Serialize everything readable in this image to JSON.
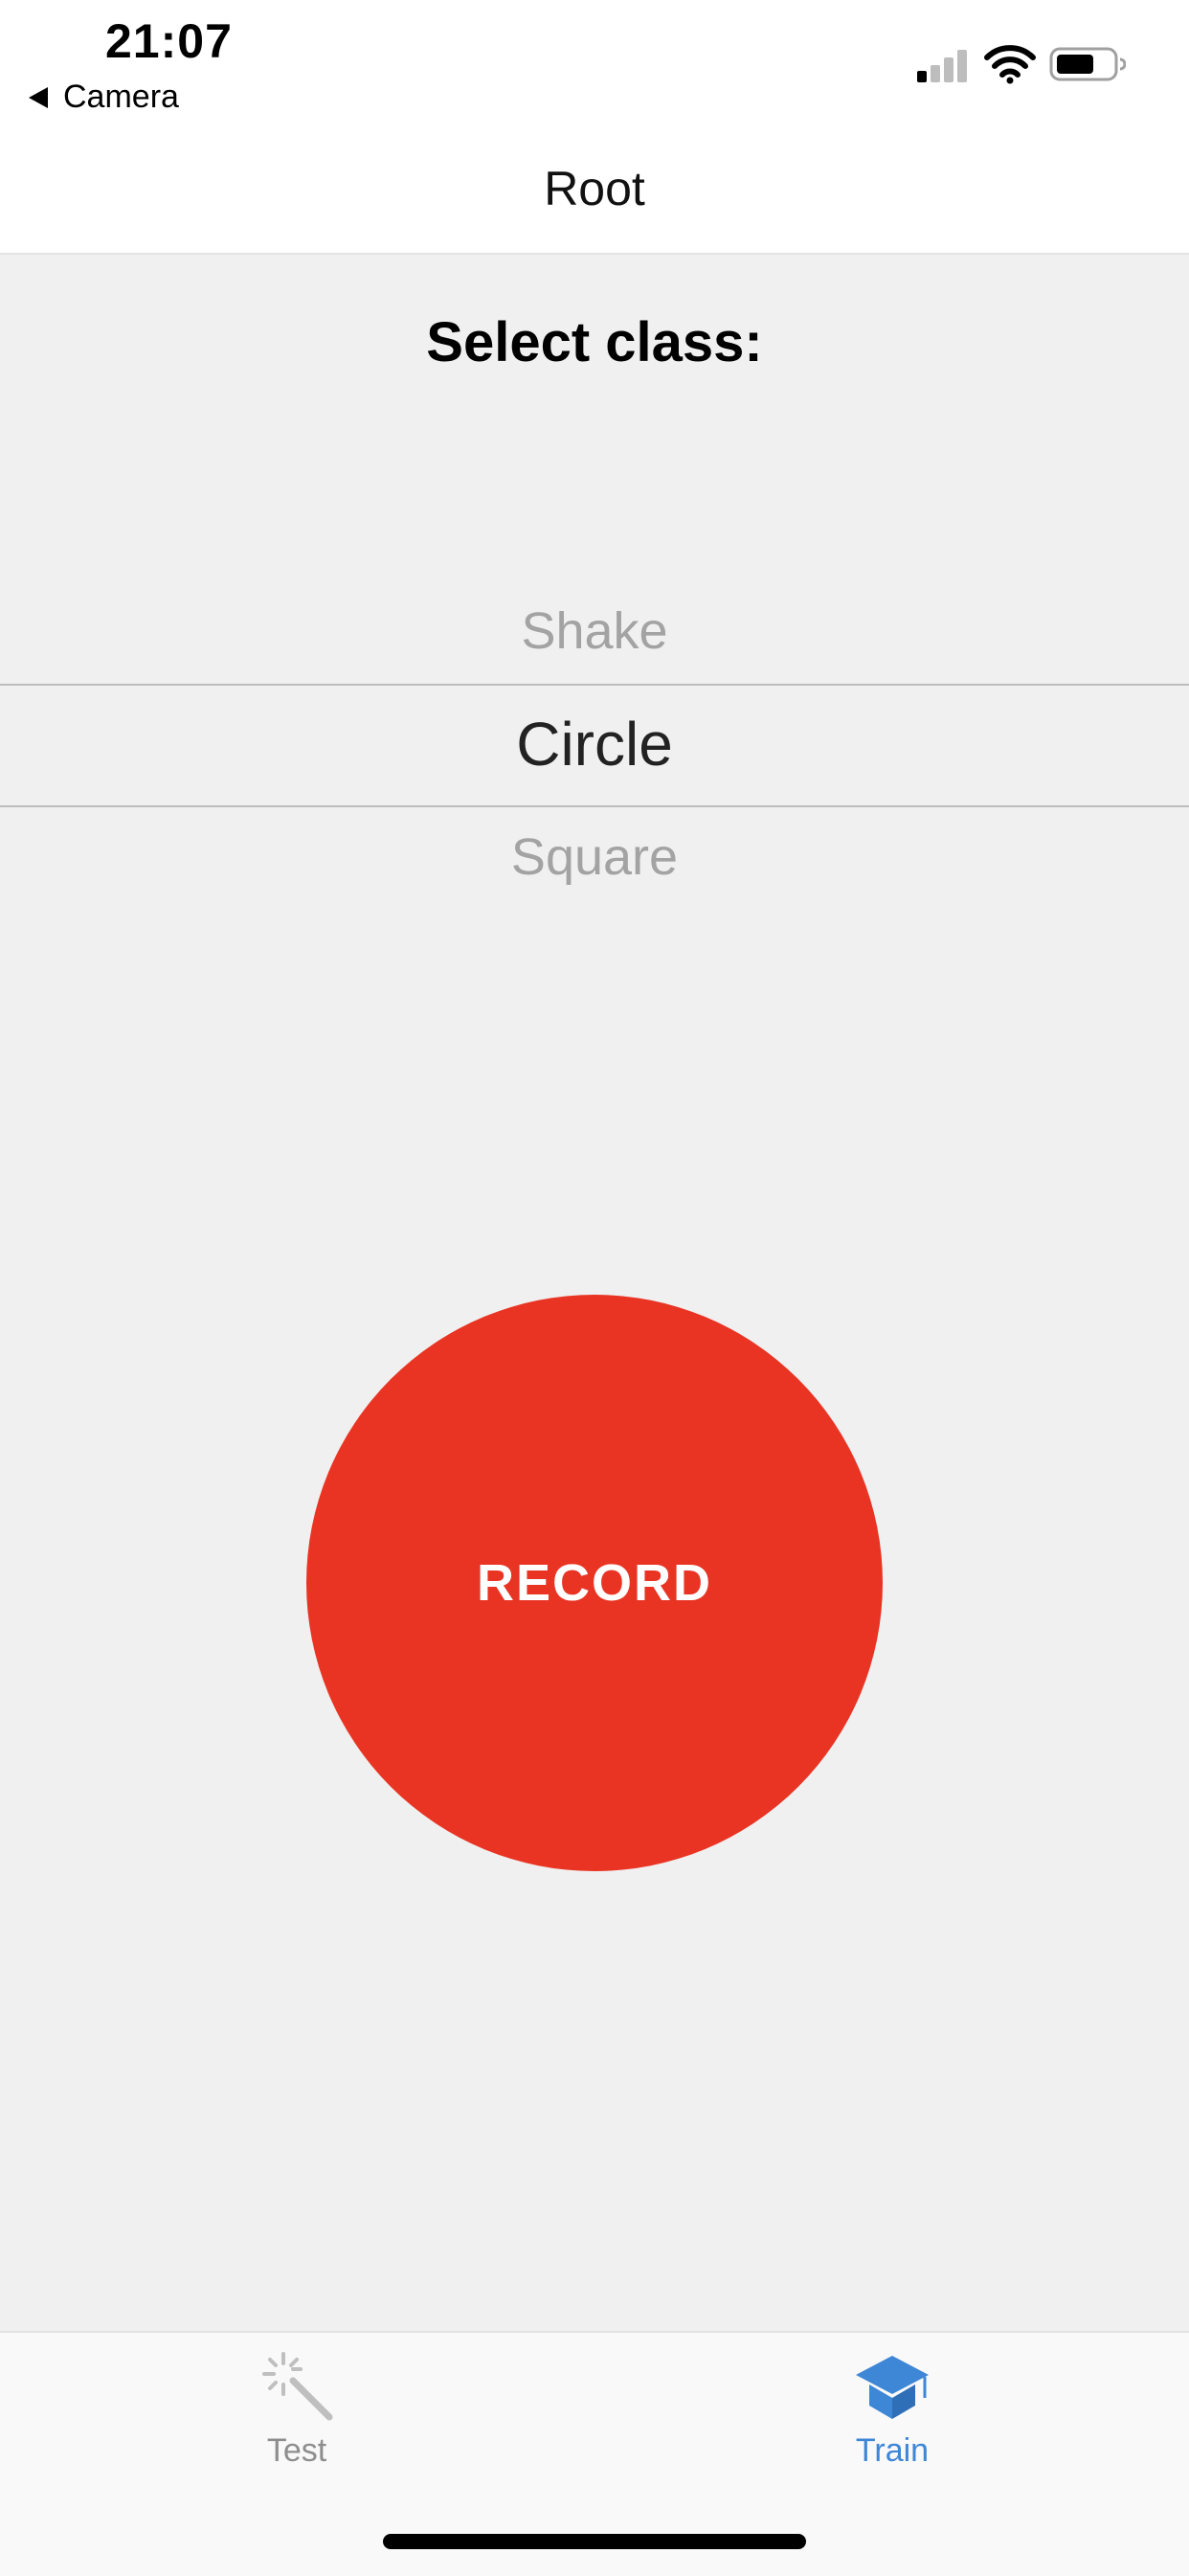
{
  "status_bar": {
    "time": "21:07",
    "back_label": "Camera"
  },
  "nav": {
    "title": "Root"
  },
  "main": {
    "section_title": "Select class:",
    "picker": {
      "items": [
        "Shake",
        "Circle",
        "Square"
      ],
      "selected": "Circle"
    },
    "record_label": "RECORD"
  },
  "tab_bar": {
    "tabs": [
      {
        "label": "Test",
        "icon": "magic-wand-icon",
        "active": false
      },
      {
        "label": "Train",
        "icon": "graduation-cap-icon",
        "active": true
      }
    ]
  },
  "colors": {
    "accent": "#e93424",
    "tab_active": "#3e86d6",
    "tab_inactive": "#8e8e8e",
    "background": "#f0f0f0"
  }
}
